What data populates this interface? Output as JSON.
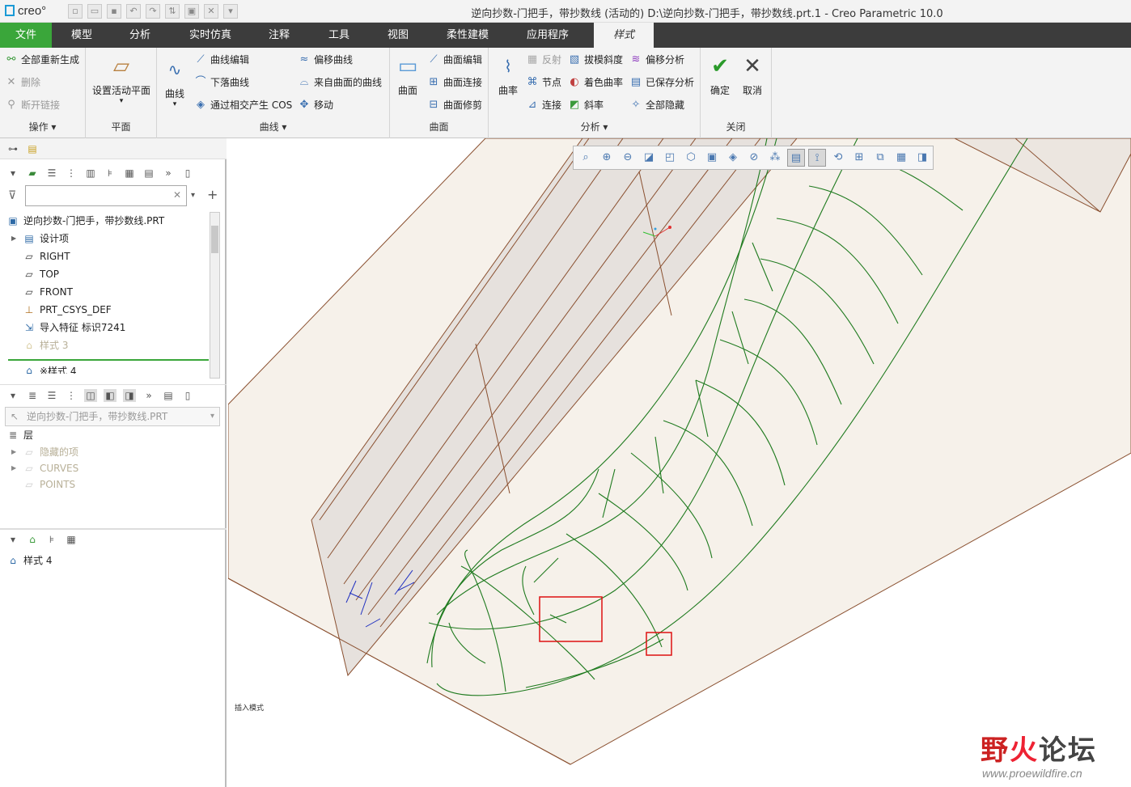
{
  "app": {
    "logo": "creo°",
    "window_title": "逆向抄数-门把手，带抄数线 (活动的) D:\\逆向抄数-门把手，带抄数线.prt.1 - Creo Parametric 10.0"
  },
  "tabs": [
    "文件",
    "模型",
    "分析",
    "实时仿真",
    "注释",
    "工具",
    "视图",
    "柔性建模",
    "应用程序",
    "样式"
  ],
  "ribbon": {
    "ops": {
      "regen": "全部重新生成",
      "delete": "删除",
      "break": "断开链接",
      "label": "操作"
    },
    "plane": {
      "set_active": "设置活动平面",
      "label": "平面"
    },
    "curves": {
      "curve": "曲线",
      "edit": "曲线编辑",
      "drop": "下落曲线",
      "cos": "通过相交产生 COS",
      "offset": "偏移曲线",
      "from_surf": "来自曲面的曲线",
      "move": "移动",
      "label": "曲线"
    },
    "surface": {
      "surface": "曲面",
      "edit": "曲面编辑",
      "connect": "曲面连接",
      "trim": "曲面修剪",
      "label": "曲面"
    },
    "analysis": {
      "curvature": "曲率",
      "reflect": "反射",
      "node": "节点",
      "connect": "连接",
      "draft": "拔模斜度",
      "shade_curv": "着色曲率",
      "slope": "斜率",
      "offset_an": "偏移分析",
      "saved": "已保存分析",
      "hide_all": "全部隐藏",
      "label": "分析"
    },
    "close": {
      "ok": "确定",
      "cancel": "取消",
      "label": "关闭"
    }
  },
  "model_tree": {
    "filter_placeholder": "",
    "items": [
      {
        "label": "逆向抄数-门把手，带抄数线.PRT",
        "icon": "part-icon"
      },
      {
        "label": "设计项",
        "icon": "design-items-icon"
      },
      {
        "label": "RIGHT",
        "icon": "datum-plane-icon"
      },
      {
        "label": "TOP",
        "icon": "datum-plane-icon"
      },
      {
        "label": "FRONT",
        "icon": "datum-plane-icon"
      },
      {
        "label": "PRT_CSYS_DEF",
        "icon": "csys-icon"
      },
      {
        "label": "导入特征 标识7241",
        "icon": "import-feature-icon"
      },
      {
        "label": "样式 3",
        "icon": "style-icon"
      },
      {
        "label": "※样式 4",
        "icon": "style-icon"
      }
    ]
  },
  "layer_tree": {
    "model_select": "逆向抄数-门把手，带抄数线.PRT",
    "root": "层",
    "items": [
      "隐藏的项",
      "CURVES",
      "POINTS"
    ]
  },
  "style_tree": {
    "item": "样式 4"
  },
  "viewport": {
    "small_text": "插入模式"
  },
  "watermark": {
    "text_a": "野",
    "text_b": "火",
    "text_c": "论坛",
    "url": "www.proewildfire.cn"
  },
  "colors": {
    "file_tab": "#3aa63a",
    "curve": "#1e7a1e",
    "highlight_box": "#dd1111",
    "surface_edge": "#8a5030",
    "surface_fill": "#f3ede6"
  }
}
